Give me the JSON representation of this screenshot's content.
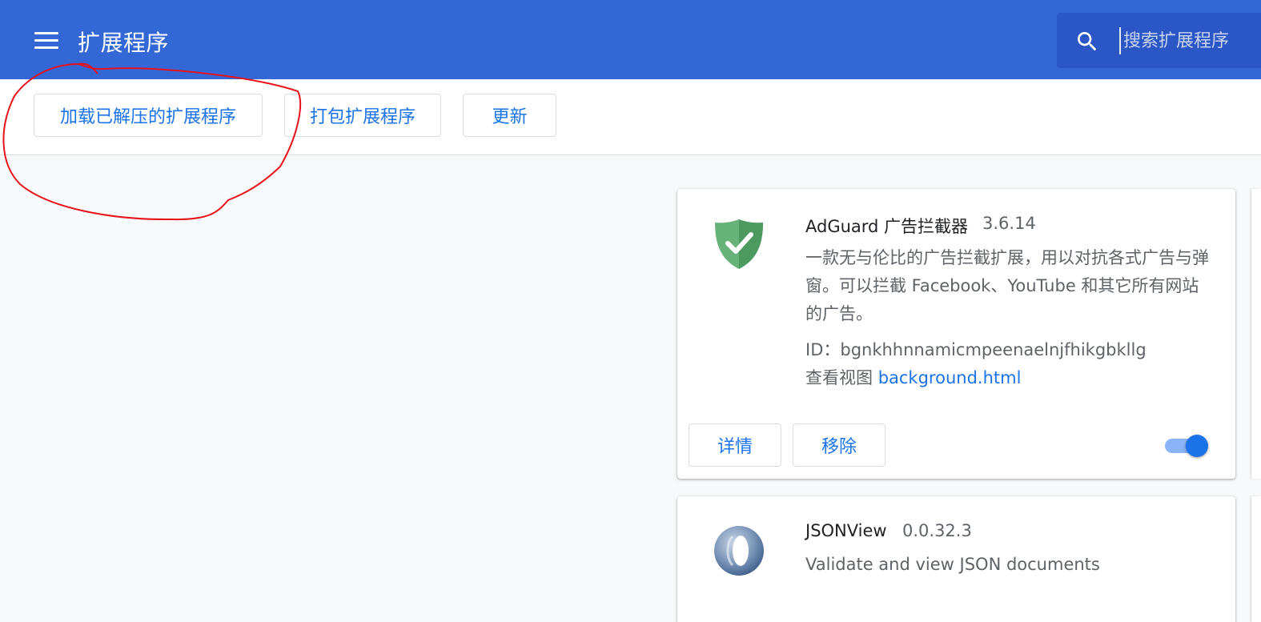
{
  "header": {
    "title": "扩展程序",
    "search_placeholder": "搜索扩展程序"
  },
  "toolbar": {
    "load_unpacked": "加载已解压的扩展程序",
    "pack": "打包扩展程序",
    "update": "更新"
  },
  "extensions": [
    {
      "name": "AdGuard 广告拦截器",
      "version": "3.6.14",
      "description": "一款无与伦比的广告拦截扩展，用以对抗各式广告与弹窗。可以拦截 Facebook、YouTube 和其它所有网站的广告。",
      "id": "ID：bgnkhhnnamicmpeenaelnjfhikgbkllg",
      "inspect_label": "查看视图",
      "inspect_link": "background.html",
      "details_label": "详情",
      "remove_label": "移除",
      "enabled": true,
      "icon": "shield-check-icon"
    },
    {
      "name": "JSONView",
      "version": "0.0.32.3",
      "description": "Validate and view JSON documents",
      "icon": "jsonview-ring-icon"
    }
  ],
  "colors": {
    "header": "#3367d6",
    "search_bg": "#2a56c6",
    "accent": "#1a73e8",
    "annotation": "#e8121a"
  }
}
